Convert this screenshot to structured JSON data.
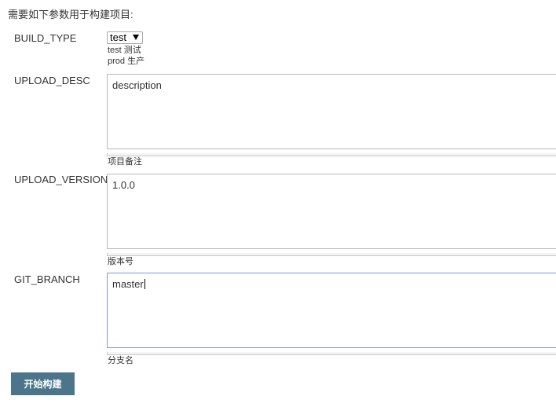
{
  "intro_text": "需要如下参数用于构建项目:",
  "params": {
    "build_type": {
      "name": "BUILD_TYPE",
      "selected": "test",
      "help_line1": "test 测试",
      "help_line2": "prod 生产"
    },
    "upload_desc": {
      "name": "UPLOAD_DESC",
      "value": "description",
      "help": "项目备注"
    },
    "upload_version": {
      "name": "UPLOAD_VERSION",
      "value": "1.0.0",
      "help": "版本号"
    },
    "git_branch": {
      "name": "GIT_BRANCH",
      "value": "master",
      "help": "分支名"
    }
  },
  "build_button_label": "开始构建",
  "colors": {
    "button_bg": "#4b758b",
    "focus_border": "#7a9bd8"
  }
}
